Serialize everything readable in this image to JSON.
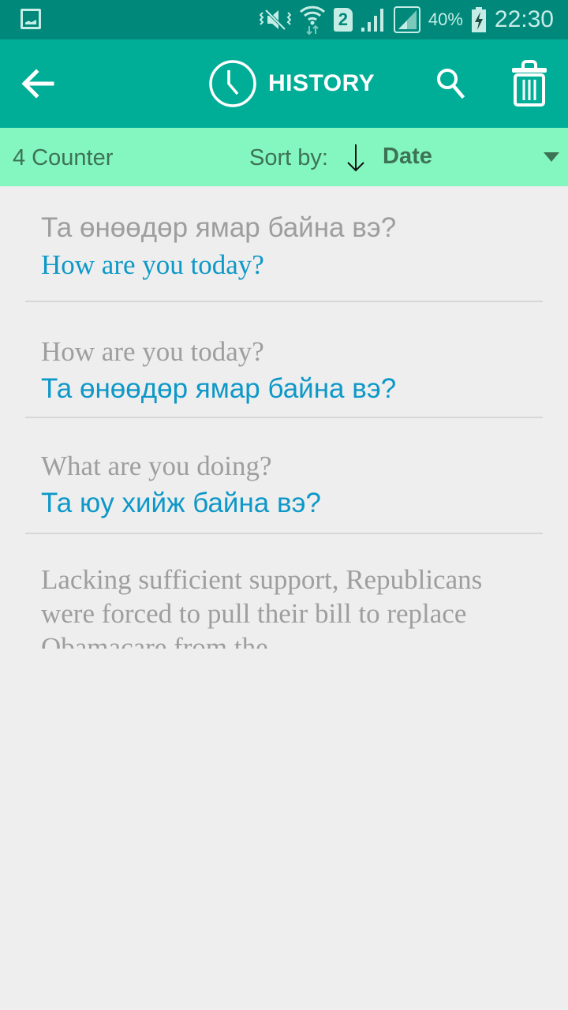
{
  "status_bar": {
    "icons": [
      "gallery-notification-icon",
      "vibrate-mute-icon",
      "wifi-data-icon",
      "sim-2-icon",
      "signal-icon",
      "signal-sim2-icon",
      "battery-charging-icon"
    ],
    "sim_label": "2",
    "battery": "40%",
    "time": "22:30"
  },
  "app_bar": {
    "title": "HISTORY",
    "back_icon": "arrow-left-icon",
    "title_icon": "clock-icon",
    "search_icon": "search-icon",
    "delete_icon": "trash-icon"
  },
  "sort_bar": {
    "counter": "4 Counter",
    "sort_label": "Sort by:",
    "sort_direction_icon": "arrow-down-icon",
    "sort_value": "Date"
  },
  "history": [
    {
      "source": "Та өнөөдөр ямар байна вэ?",
      "translation": "How are you today?"
    },
    {
      "source": "How are you today?",
      "translation": "Та өнөөдөр ямар байна вэ?"
    },
    {
      "source": "What are you doing?",
      "translation": "Та юу хийж байна вэ?"
    },
    {
      "source": "Lacking sufficient support, Republicans were forced to pull their bill to replace Obamacare from the",
      "translation": ""
    }
  ],
  "colors": {
    "status_bar": "#00897b",
    "app_bar": "#00ae98",
    "sort_bar": "#84f7c0",
    "source_text": "#9e9e9e",
    "translation_text": "#0e98c8",
    "background": "#eeeeee"
  }
}
